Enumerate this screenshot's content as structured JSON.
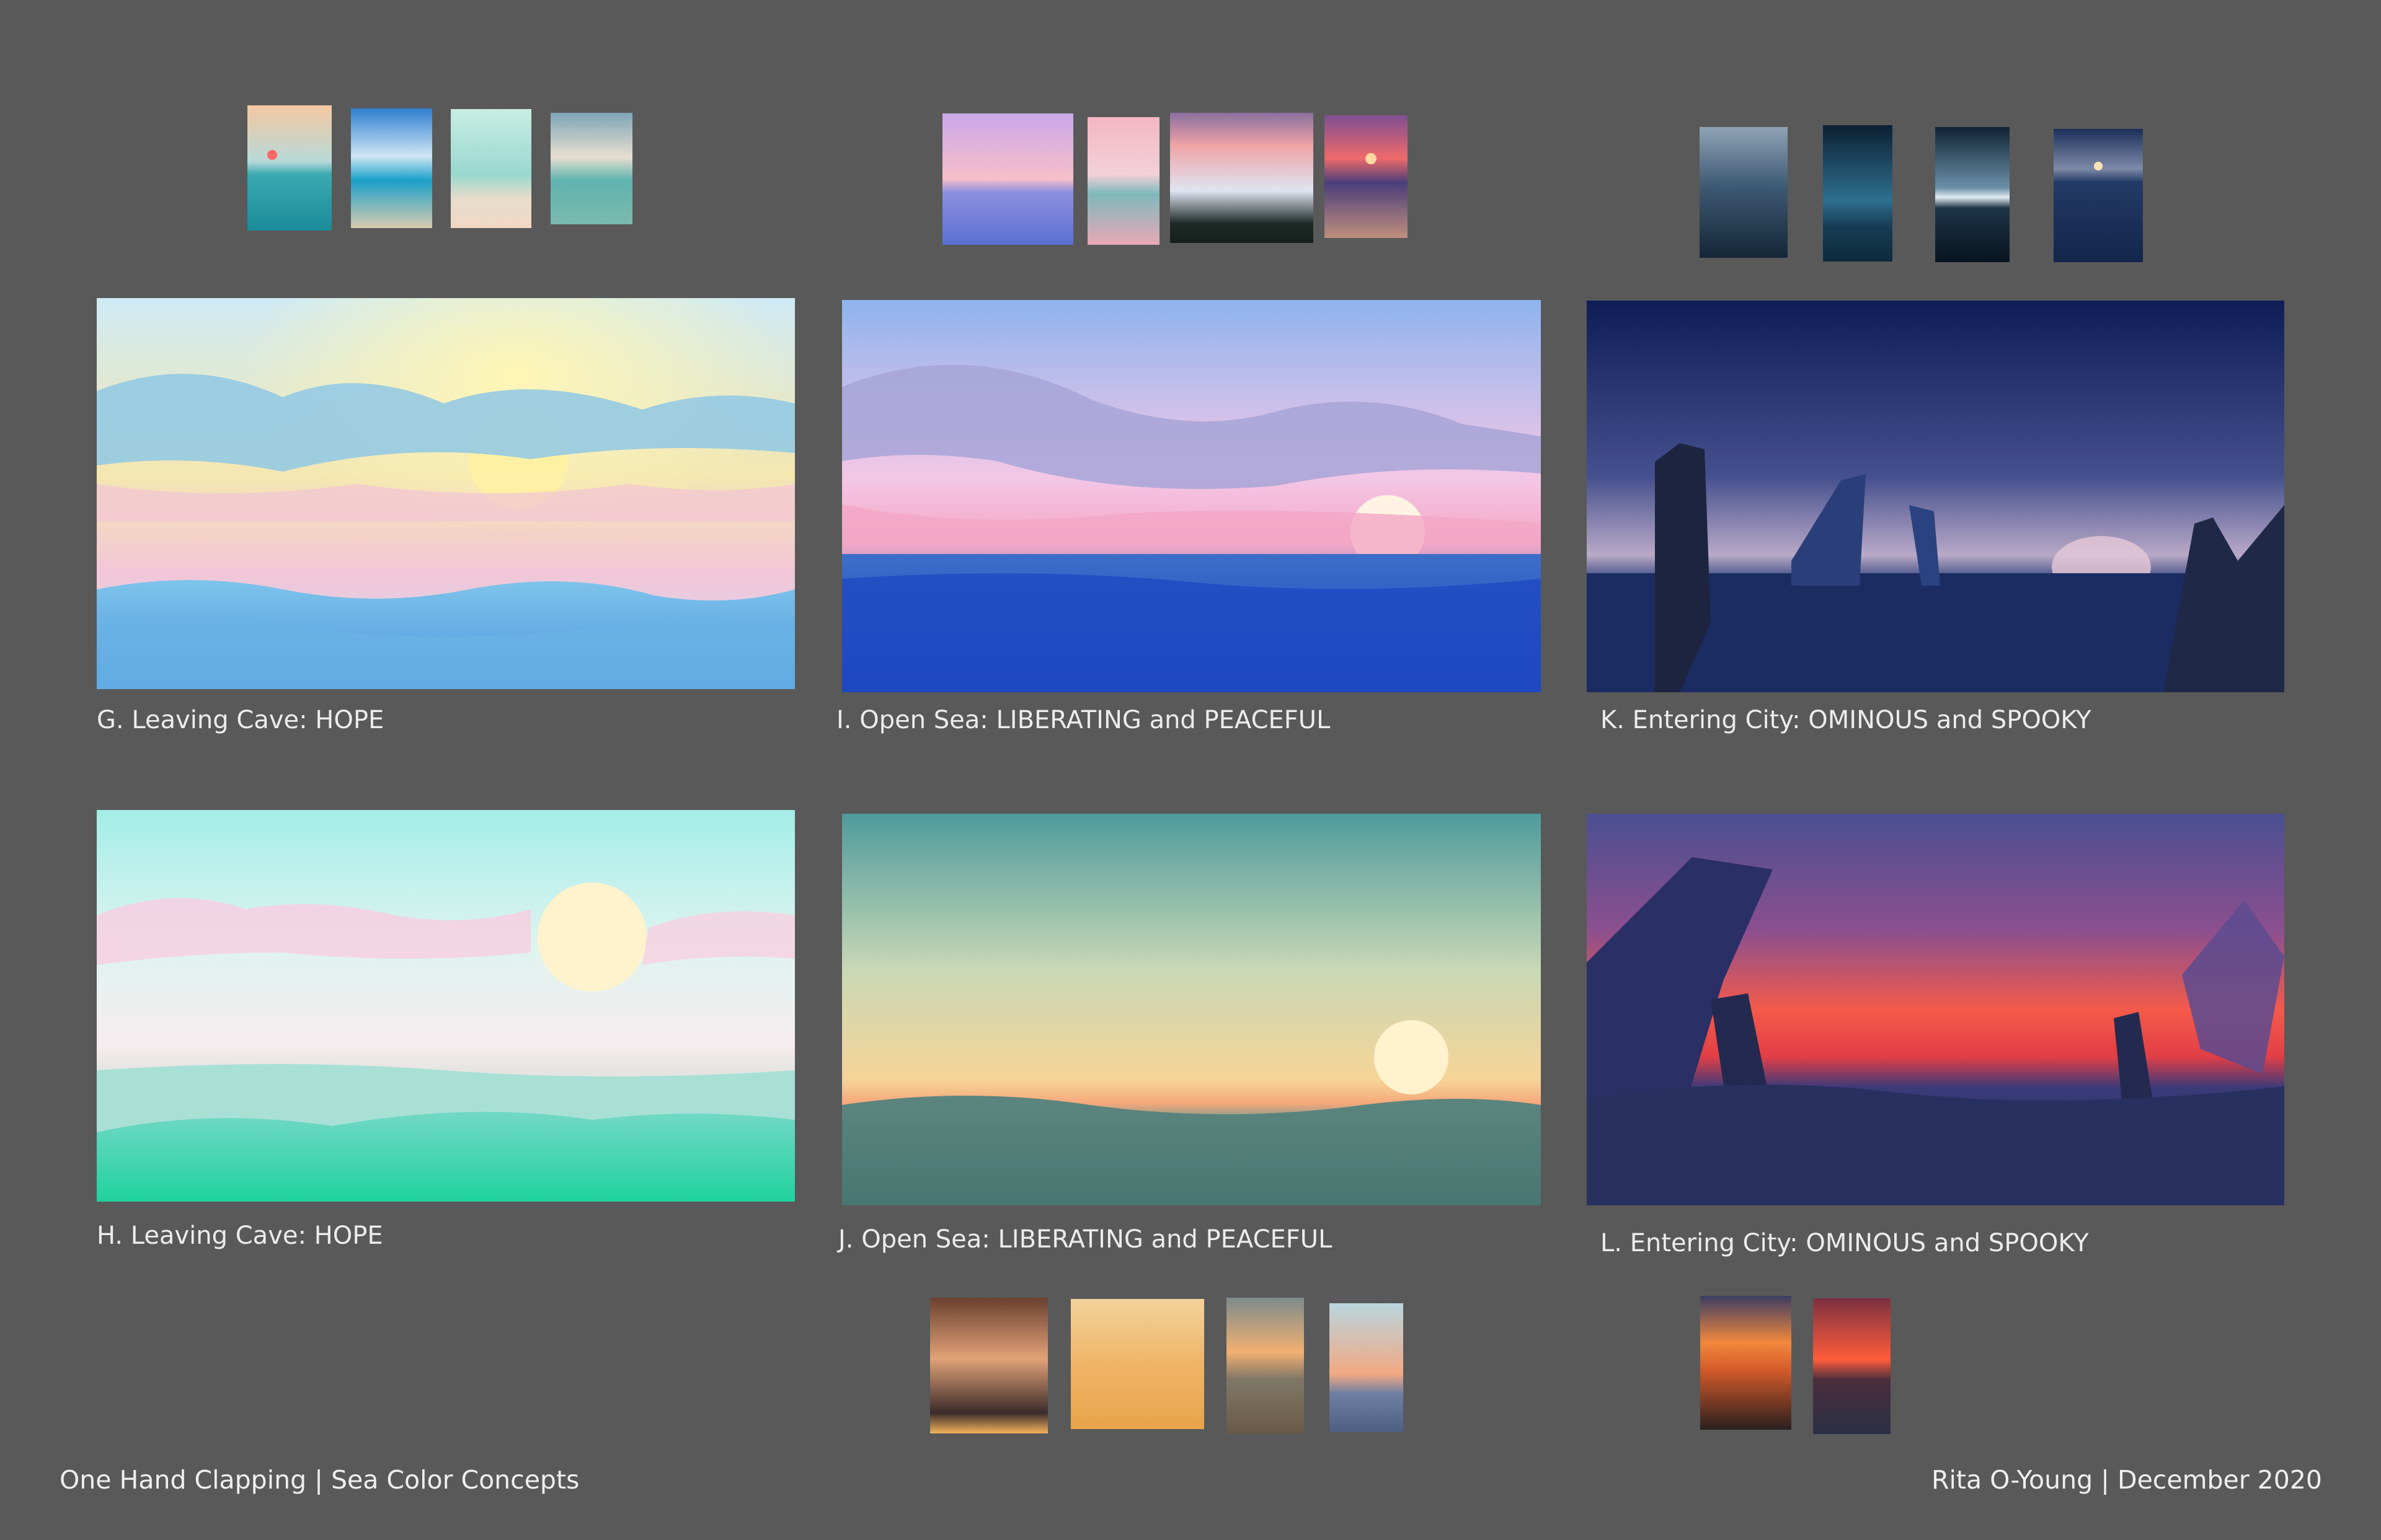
{
  "board": {
    "footer_left": "One Hand Clapping | Sea Color Concepts",
    "footer_right": "Rita O-Young | December 2020"
  },
  "panels": [
    {
      "caption": "G. Leaving Cave: HOPE"
    },
    {
      "caption": "I. Open Sea: LIBERATING and PEACEFUL"
    },
    {
      "caption": "K. Entering City: OMINOUS and SPOOKY"
    },
    {
      "caption": "H. Leaving Cave: HOPE"
    },
    {
      "caption": "J. Open Sea: LIBERATING and PEACEFUL"
    },
    {
      "caption": "L. Entering City: OMINOUS and SPOOKY"
    }
  ],
  "colors": {
    "background": "#595959",
    "caption_text": "#ececec"
  }
}
